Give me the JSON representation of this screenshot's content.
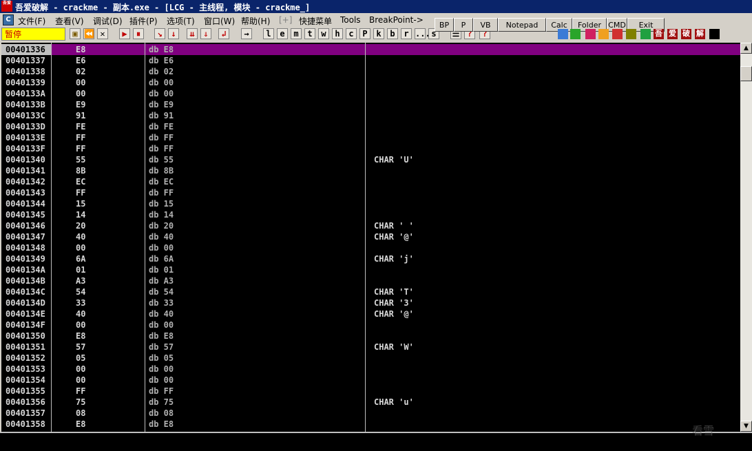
{
  "window": {
    "logo_text": "吾爱",
    "title": "吾爱破解 - crackme - 副本.exe - [LCG - 主线程, 模块 - crackme_]"
  },
  "menu": {
    "app_icon": "C",
    "items": [
      "文件(F)",
      "查看(V)",
      "调试(D)",
      "插件(P)",
      "选项(T)",
      "窗口(W)",
      "帮助(H)",
      "[+]",
      "快捷菜单",
      "Tools",
      "BreakPoint->"
    ]
  },
  "quickbar": [
    "BP",
    "P",
    "VB",
    "Notepad",
    "Calc",
    "Folder",
    "CMD",
    "Exit"
  ],
  "toolbar": {
    "status": "暂停",
    "letters": [
      "l",
      "e",
      "m",
      "t",
      "w",
      "h",
      "c",
      "P",
      "k",
      "b",
      "r",
      "...",
      "s"
    ],
    "plugin_labels": [
      "吾",
      "爱",
      "破",
      "解"
    ]
  },
  "rows": [
    {
      "addr": "00401336",
      "hex": "E8",
      "dis": "db E8",
      "comment": ""
    },
    {
      "addr": "00401337",
      "hex": "E6",
      "dis": "db E6",
      "comment": ""
    },
    {
      "addr": "00401338",
      "hex": "02",
      "dis": "db 02",
      "comment": ""
    },
    {
      "addr": "00401339",
      "hex": "00",
      "dis": "db 00",
      "comment": ""
    },
    {
      "addr": "0040133A",
      "hex": "00",
      "dis": "db 00",
      "comment": ""
    },
    {
      "addr": "0040133B",
      "hex": "E9",
      "dis": "db E9",
      "comment": ""
    },
    {
      "addr": "0040133C",
      "hex": "91",
      "dis": "db 91",
      "comment": ""
    },
    {
      "addr": "0040133D",
      "hex": "FE",
      "dis": "db FE",
      "comment": ""
    },
    {
      "addr": "0040133E",
      "hex": "FF",
      "dis": "db FF",
      "comment": ""
    },
    {
      "addr": "0040133F",
      "hex": "FF",
      "dis": "db FF",
      "comment": ""
    },
    {
      "addr": "00401340",
      "hex": "55",
      "dis": "db 55",
      "comment": "CHAR 'U'"
    },
    {
      "addr": "00401341",
      "hex": "8B",
      "dis": "db 8B",
      "comment": ""
    },
    {
      "addr": "00401342",
      "hex": "EC",
      "dis": "db EC",
      "comment": ""
    },
    {
      "addr": "00401343",
      "hex": "FF",
      "dis": "db FF",
      "comment": ""
    },
    {
      "addr": "00401344",
      "hex": "15",
      "dis": "db 15",
      "comment": ""
    },
    {
      "addr": "00401345",
      "hex": "14",
      "dis": "db 14",
      "comment": ""
    },
    {
      "addr": "00401346",
      "hex": "20",
      "dis": "db 20",
      "comment": "CHAR ' '"
    },
    {
      "addr": "00401347",
      "hex": "40",
      "dis": "db 40",
      "comment": "CHAR '@'"
    },
    {
      "addr": "00401348",
      "hex": "00",
      "dis": "db 00",
      "comment": ""
    },
    {
      "addr": "00401349",
      "hex": "6A",
      "dis": "db 6A",
      "comment": "CHAR 'j'"
    },
    {
      "addr": "0040134A",
      "hex": "01",
      "dis": "db 01",
      "comment": ""
    },
    {
      "addr": "0040134B",
      "hex": "A3",
      "dis": "db A3",
      "comment": ""
    },
    {
      "addr": "0040134C",
      "hex": "54",
      "dis": "db 54",
      "comment": "CHAR 'T'"
    },
    {
      "addr": "0040134D",
      "hex": "33",
      "dis": "db 33",
      "comment": "CHAR '3'"
    },
    {
      "addr": "0040134E",
      "hex": "40",
      "dis": "db 40",
      "comment": "CHAR '@'"
    },
    {
      "addr": "0040134F",
      "hex": "00",
      "dis": "db 00",
      "comment": ""
    },
    {
      "addr": "00401350",
      "hex": "E8",
      "dis": "db E8",
      "comment": ""
    },
    {
      "addr": "00401351",
      "hex": "57",
      "dis": "db 57",
      "comment": "CHAR 'W'"
    },
    {
      "addr": "00401352",
      "hex": "05",
      "dis": "db 05",
      "comment": ""
    },
    {
      "addr": "00401353",
      "hex": "00",
      "dis": "db 00",
      "comment": ""
    },
    {
      "addr": "00401354",
      "hex": "00",
      "dis": "db 00",
      "comment": ""
    },
    {
      "addr": "00401355",
      "hex": "FF",
      "dis": "db FF",
      "comment": ""
    },
    {
      "addr": "00401356",
      "hex": "75",
      "dis": "db 75",
      "comment": "CHAR 'u'"
    },
    {
      "addr": "00401357",
      "hex": "08",
      "dis": "db 08",
      "comment": ""
    },
    {
      "addr": "00401358",
      "hex": "E8",
      "dis": "db E8",
      "comment": ""
    }
  ],
  "selected_row": 0,
  "watermark": "看雪",
  "colors": {
    "selection": "#800080",
    "status_bg": "#ffff00",
    "title_bg": "#0a246a"
  }
}
